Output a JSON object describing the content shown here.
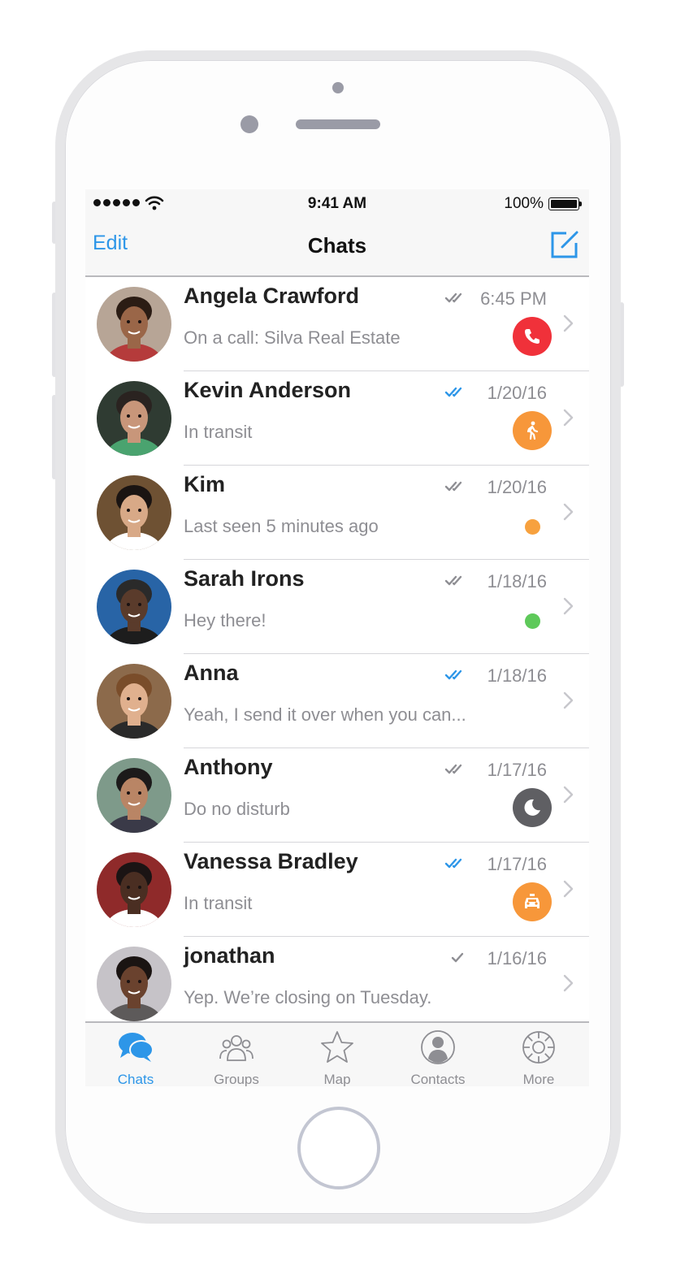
{
  "status_bar": {
    "time": "9:41 AM",
    "battery": "100%"
  },
  "nav": {
    "edit": "Edit",
    "title": "Chats"
  },
  "chats": [
    {
      "name": "Angela Crawford",
      "preview": "On a call: Silva Real Estate",
      "date": "6:45 PM",
      "read": "gray",
      "status": "call",
      "status_color": "#f0313a"
    },
    {
      "name": "Kevin Anderson",
      "preview": "In transit",
      "date": "1/20/16",
      "read": "blue",
      "status": "walking",
      "status_color": "#f7973a"
    },
    {
      "name": "Kim",
      "preview": "Last seen 5 minutes ago",
      "date": "1/20/16",
      "read": "gray",
      "status": "away-dot",
      "status_color": "#f7a13e"
    },
    {
      "name": "Sarah Irons",
      "preview": "Hey there!",
      "date": "1/18/16",
      "read": "gray",
      "status": "online-dot",
      "status_color": "#5ec95a"
    },
    {
      "name": "Anna",
      "preview": "Yeah, I send it over when you can...",
      "date": "1/18/16",
      "read": "blue",
      "status": "none",
      "status_color": ""
    },
    {
      "name": "Anthony",
      "preview": "Do no disturb",
      "date": "1/17/16",
      "read": "gray",
      "status": "moon",
      "status_color": "#5f5f63"
    },
    {
      "name": "Vanessa Bradley",
      "preview": "In transit",
      "date": "1/17/16",
      "read": "blue",
      "status": "taxi",
      "status_color": "#f7973a"
    },
    {
      "name": "jonathan",
      "preview": "Yep. We’re closing on Tuesday.",
      "date": "1/16/16",
      "read": "single-gray",
      "status": "none",
      "status_color": ""
    }
  ],
  "tabs": [
    {
      "label": "Chats",
      "icon": "chat-bubbles-icon",
      "active": true
    },
    {
      "label": "Groups",
      "icon": "groups-icon",
      "active": false
    },
    {
      "label": "Map",
      "icon": "star-icon",
      "active": false
    },
    {
      "label": "Contacts",
      "icon": "contact-icon",
      "active": false
    },
    {
      "label": "More",
      "icon": "gear-icon",
      "active": false
    }
  ],
  "colors": {
    "accent": "#2d96e8",
    "text_secondary": "#8e8e93"
  }
}
